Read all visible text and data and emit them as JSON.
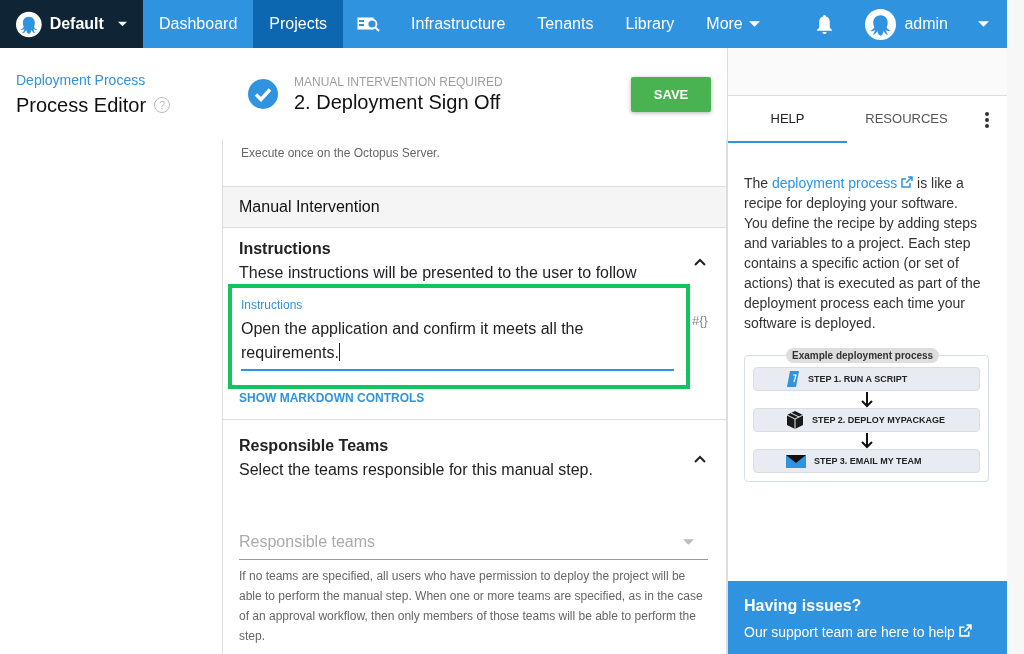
{
  "nav": {
    "workspace": "Default",
    "items": [
      {
        "kind": "text",
        "label": "Dashboard",
        "selected": false,
        "dropdown": false
      },
      {
        "kind": "text",
        "label": "Projects",
        "selected": true,
        "dropdown": false
      },
      {
        "kind": "icon",
        "selected": false
      },
      {
        "kind": "text",
        "label": "Infrastructure",
        "selected": false,
        "dropdown": false
      },
      {
        "kind": "text",
        "label": "Tenants",
        "selected": false,
        "dropdown": false
      },
      {
        "kind": "text",
        "label": "Library",
        "selected": false,
        "dropdown": false
      },
      {
        "kind": "text",
        "label": "More",
        "selected": false,
        "dropdown": true
      }
    ],
    "user": "admin"
  },
  "header": {
    "breadcrumb": "Deployment Process",
    "title": "Process Editor",
    "help_mark": "?",
    "step_type": "MANUAL INTERVENTION REQUIRED",
    "step_title": "2.  Deployment Sign Off",
    "save": "SAVE"
  },
  "execution_note": "Execute once on the Octopus Server.",
  "section_title": "Manual Intervention",
  "instructions": {
    "title": "Instructions",
    "description": "These instructions will be presented to the user to follow",
    "expanded": true,
    "field_label": "Instructions",
    "value": "Open the application and confirm it meets all the requirements.",
    "focused": true,
    "variable_button": "#{}",
    "markdown_link": "SHOW MARKDOWN CONTROLS"
  },
  "teams": {
    "title": "Responsible Teams",
    "description": "Select the teams responsible for this manual step.",
    "expanded": true,
    "placeholder": "Responsible teams",
    "note": "If no teams are specified, all users who have permission to deploy the project will be able to perform the manual step. When one or more teams are specified, as in the case of an approval workflow, then only members of those teams will be able to perform the step."
  },
  "sidebar": {
    "tabs": [
      {
        "label": "HELP",
        "selected": true
      },
      {
        "label": "RESOURCES",
        "selected": false
      }
    ],
    "help": {
      "before": "The ",
      "link": "deployment process",
      "after": " is like a recipe for deploying your software. You define the recipe by adding steps and variables to a project. Each step contains a specific action (or set of actions) that is executed as part of the deployment process each time your software is deployed."
    },
    "example": {
      "title": "Example deployment process",
      "steps": [
        {
          "kind": "script",
          "label": "STEP 1. RUN A SCRIPT"
        },
        {
          "kind": "package",
          "label": "STEP 2. DEPLOY MYPACKAGE"
        },
        {
          "kind": "email",
          "label": "STEP 3. EMAIL MY TEAM"
        }
      ]
    },
    "support": {
      "title": "Having issues?",
      "link": "Our support team are here to help"
    }
  }
}
